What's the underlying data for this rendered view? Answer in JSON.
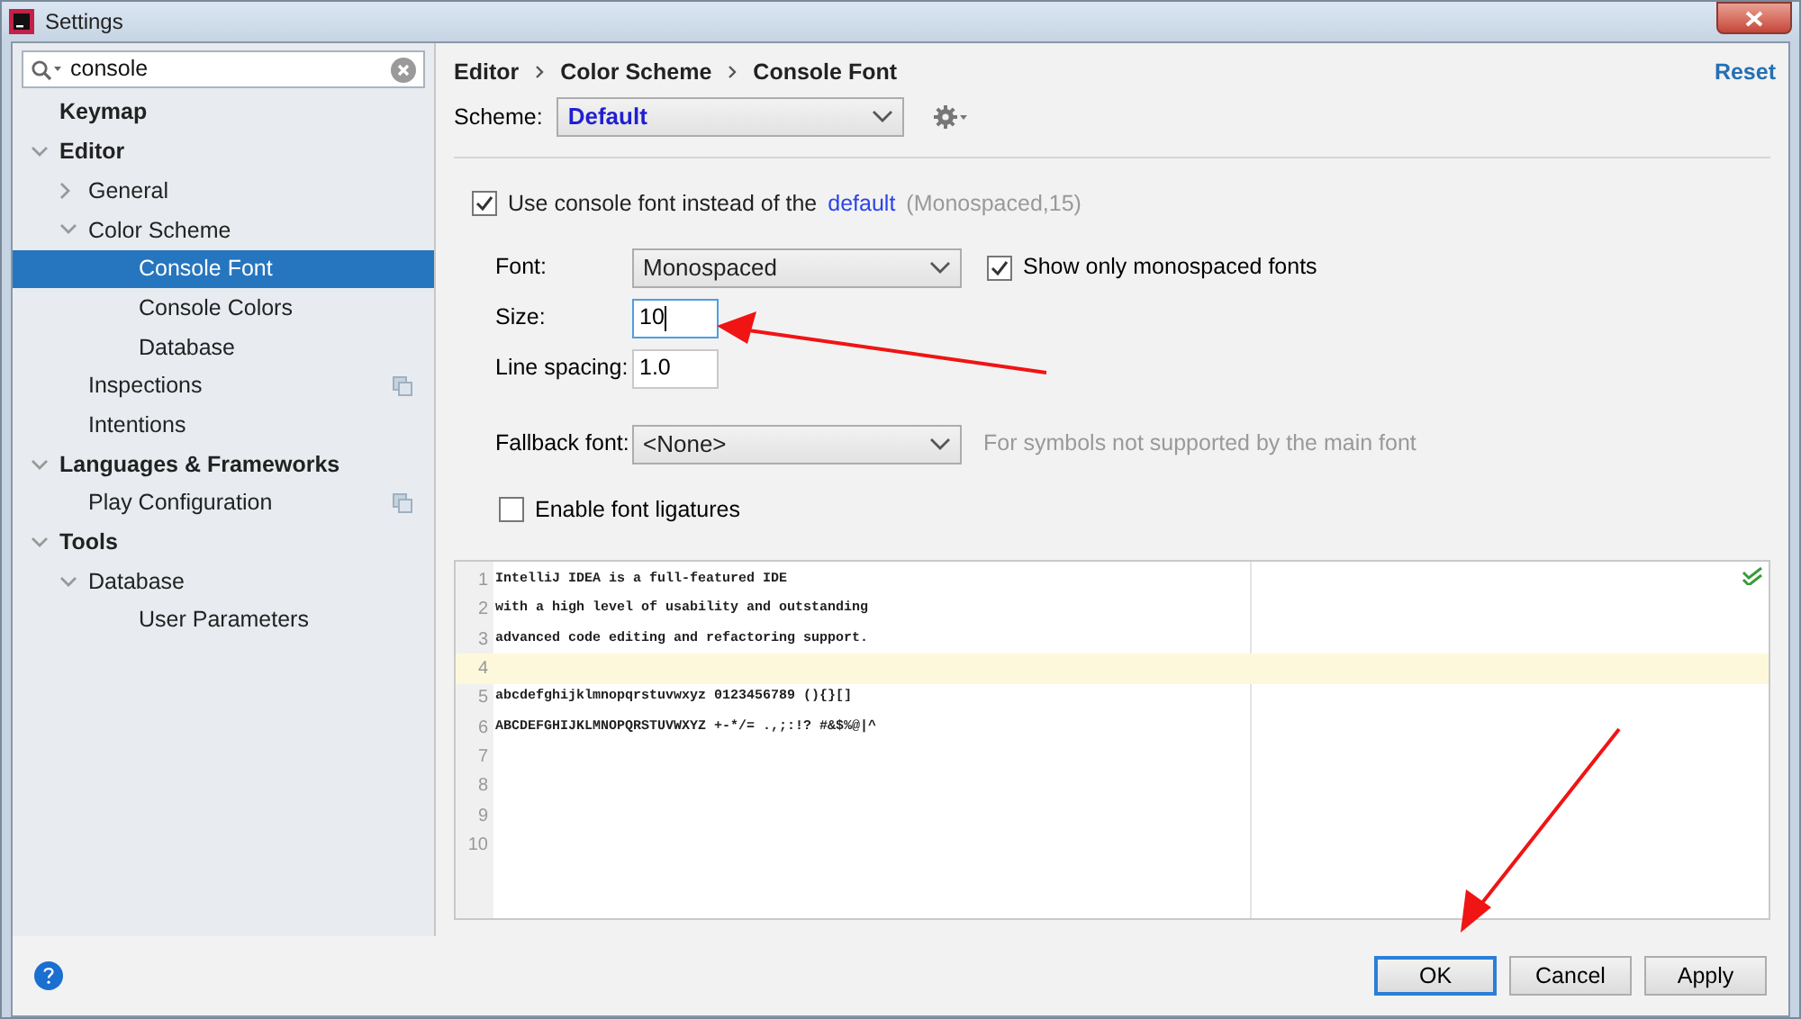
{
  "window": {
    "title": "Settings"
  },
  "search": {
    "value": "console"
  },
  "sidebar": {
    "items": [
      {
        "label": "Keymap",
        "selected": false,
        "copy_icon": false
      },
      {
        "label": "Editor",
        "expanded": true,
        "selected": false,
        "copy_icon": false,
        "children": [
          {
            "label": "General",
            "expanded": false,
            "selected": false,
            "copy_icon": false
          },
          {
            "label": "Color Scheme",
            "expanded": true,
            "selected": false,
            "copy_icon": false,
            "children": [
              {
                "label": "Console Font",
                "selected": true,
                "copy_icon": false
              },
              {
                "label": "Console Colors",
                "selected": false,
                "copy_icon": false
              },
              {
                "label": "Database",
                "selected": false,
                "copy_icon": false
              }
            ]
          },
          {
            "label": "Inspections",
            "selected": false,
            "copy_icon": true
          },
          {
            "label": "Intentions",
            "selected": false,
            "copy_icon": false
          }
        ]
      },
      {
        "label": "Languages & Frameworks",
        "expanded": true,
        "selected": false,
        "copy_icon": false,
        "children": [
          {
            "label": "Play Configuration",
            "selected": false,
            "copy_icon": true
          }
        ]
      },
      {
        "label": "Tools",
        "expanded": true,
        "selected": false,
        "copy_icon": false,
        "children": [
          {
            "label": "Database",
            "expanded": true,
            "selected": false,
            "copy_icon": false,
            "children": [
              {
                "label": "User Parameters",
                "selected": false,
                "copy_icon": false
              }
            ]
          }
        ]
      }
    ]
  },
  "breadcrumb": [
    "Editor",
    "Color Scheme",
    "Console Font"
  ],
  "reset": "Reset",
  "scheme": {
    "label": "Scheme:",
    "value": "Default"
  },
  "use_console_font": {
    "checked": true,
    "text": "Use console font instead of the",
    "link": "default",
    "hint": "(Monospaced,15)"
  },
  "font": {
    "label": "Font:",
    "value": "Monospaced"
  },
  "monospaced_only": {
    "checked": true,
    "label": "Show only monospaced fonts"
  },
  "size": {
    "label": "Size:",
    "value": "10"
  },
  "line_spacing": {
    "label": "Line spacing:",
    "value": "1.0"
  },
  "fallback": {
    "label": "Fallback font:",
    "value": "<None>",
    "hint": "For symbols not supported by the main font"
  },
  "ligatures": {
    "checked": false,
    "label": "Enable font ligatures"
  },
  "preview": {
    "lines": [
      {
        "number": "1",
        "text": "IntelliJ IDEA is a full-featured IDE",
        "current": false
      },
      {
        "number": "2",
        "text": "with a high level of usability and outstanding",
        "current": false
      },
      {
        "number": "3",
        "text": "advanced code editing and refactoring support.",
        "current": false
      },
      {
        "number": "4",
        "current": true
      },
      {
        "number": "5",
        "text": "abcdefghijklmnopqrstuvwxyz 0123456789 (){}[]",
        "current": false
      },
      {
        "number": "6",
        "text": "ABCDEFGHIJKLMNOPQRSTUVWXYZ +-*/= .,;:!? #&$%@|^",
        "current": false
      },
      {
        "number": "7",
        "current": false
      },
      {
        "number": "8",
        "current": false
      },
      {
        "number": "9",
        "current": false
      },
      {
        "number": "10",
        "current": false
      }
    ]
  },
  "buttons": [
    {
      "label": "OK",
      "default": true
    },
    {
      "label": "Cancel",
      "default": false
    },
    {
      "label": "Apply",
      "default": false
    }
  ]
}
